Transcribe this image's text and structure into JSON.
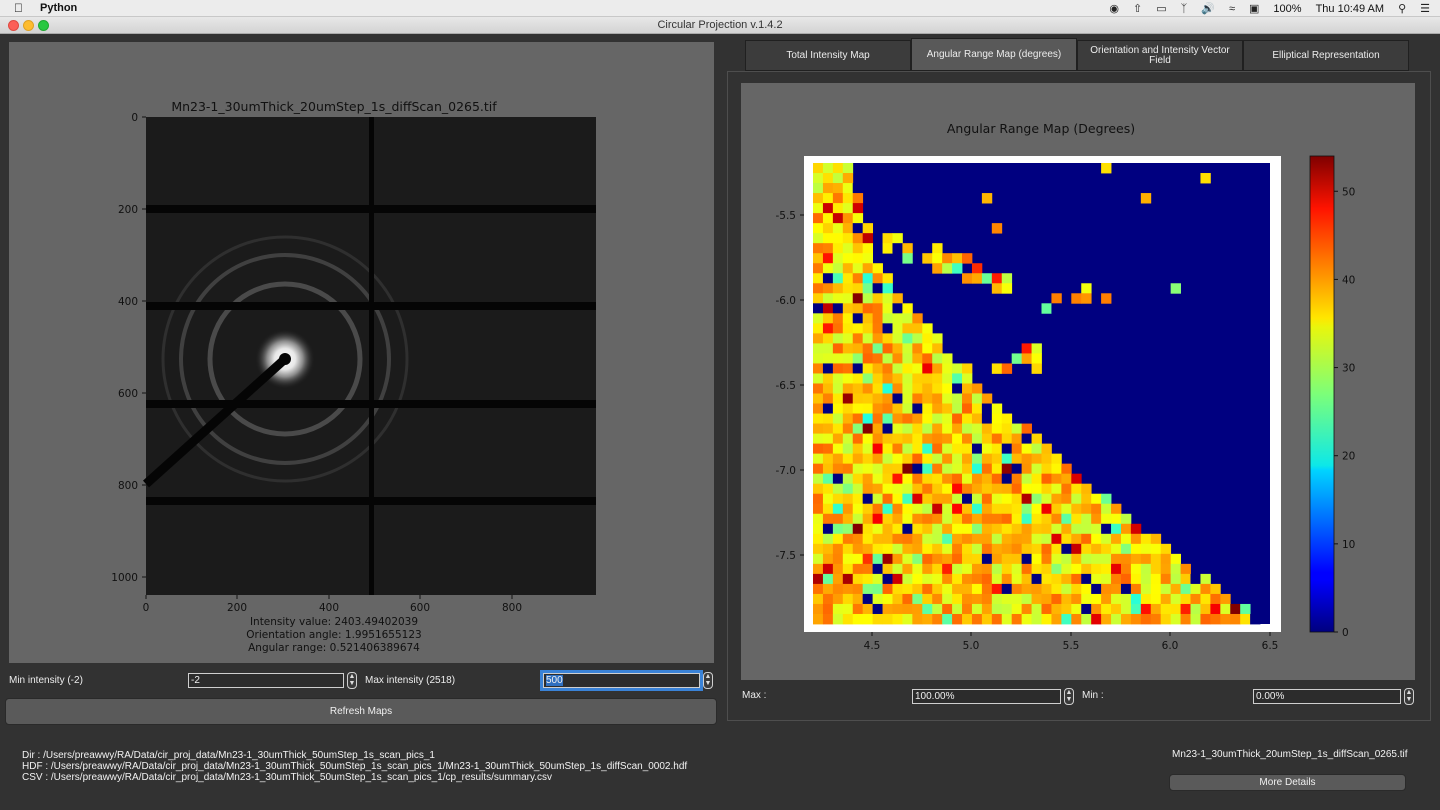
{
  "menubar": {
    "app_name": "Python",
    "battery": "100%",
    "clock": "Thu 10:49 AM"
  },
  "window": {
    "title": "Circular Projection v.1.4.2"
  },
  "diffraction": {
    "title": "Mn23-1_30umThick_20umStep_1s_diffScan_0265.tif",
    "y_ticks": [
      "0",
      "200",
      "400",
      "600",
      "800",
      "1000"
    ],
    "x_ticks": [
      "0",
      "200",
      "400",
      "600",
      "800"
    ],
    "intensity_value": "Intensity value: 2403.49402039",
    "orientation_angle": "Orientation angle: 1.9951655123",
    "angular_range": "Angular range: 0.521406389674"
  },
  "controls": {
    "min_intensity_label": "Min intensity (-2)",
    "min_intensity_value": "-2",
    "max_intensity_label": "Max intensity (2518)",
    "max_intensity_value": "500",
    "refresh_label": "Refresh Maps"
  },
  "tabs": [
    {
      "label": "Total Intensity Map"
    },
    {
      "label": "Angular Range Map (degrees)"
    },
    {
      "label": "Orientation and Intensity Vector Field"
    },
    {
      "label": "Elliptical Representation"
    }
  ],
  "active_tab": 1,
  "map": {
    "title": "Angular Range Map (Degrees)",
    "max_label": "Max :",
    "max_value": "100.00%",
    "min_label": "Min :",
    "min_value": "0.00%"
  },
  "chart_data": {
    "type": "heatmap",
    "title": "Angular Range Map (Degrees)",
    "xlim": [
      4.2,
      6.5
    ],
    "ylim": [
      -7.9,
      -5.2
    ],
    "x_ticks": [
      "4.5",
      "5.0",
      "5.5",
      "6.0",
      "6.5"
    ],
    "y_ticks": [
      "-5.5",
      "-6.0",
      "-6.5",
      "-7.0",
      "-7.5"
    ],
    "colorbar": {
      "min": 0,
      "max": 54,
      "ticks": [
        "0",
        "10",
        "20",
        "30",
        "40",
        "50"
      ],
      "colormap": "jet"
    },
    "grid": {
      "cols": 46,
      "rows": 46
    }
  },
  "footer": {
    "dir": "Dir : /Users/preawwy/RA/Data/cir_proj_data/Mn23-1_30umThick_50umStep_1s_scan_pics_1",
    "hdf": "HDF : /Users/preawwy/RA/Data/cir_proj_data/Mn23-1_30umThick_50umStep_1s_scan_pics_1/Mn23-1_30umThick_50umStep_1s_diffScan_0002.hdf",
    "csv": "CSV : /Users/preawwy/RA/Data/cir_proj_data/Mn23-1_30umThick_50umStep_1s_scan_pics_1/cp_results/summary.csv",
    "file_name": "Mn23-1_30umThick_20umStep_1s_diffScan_0265.tif",
    "more_details": "More Details"
  },
  "colors": {
    "panel": "#666666",
    "window_bg": "#323232",
    "map_background": "#00008f"
  }
}
